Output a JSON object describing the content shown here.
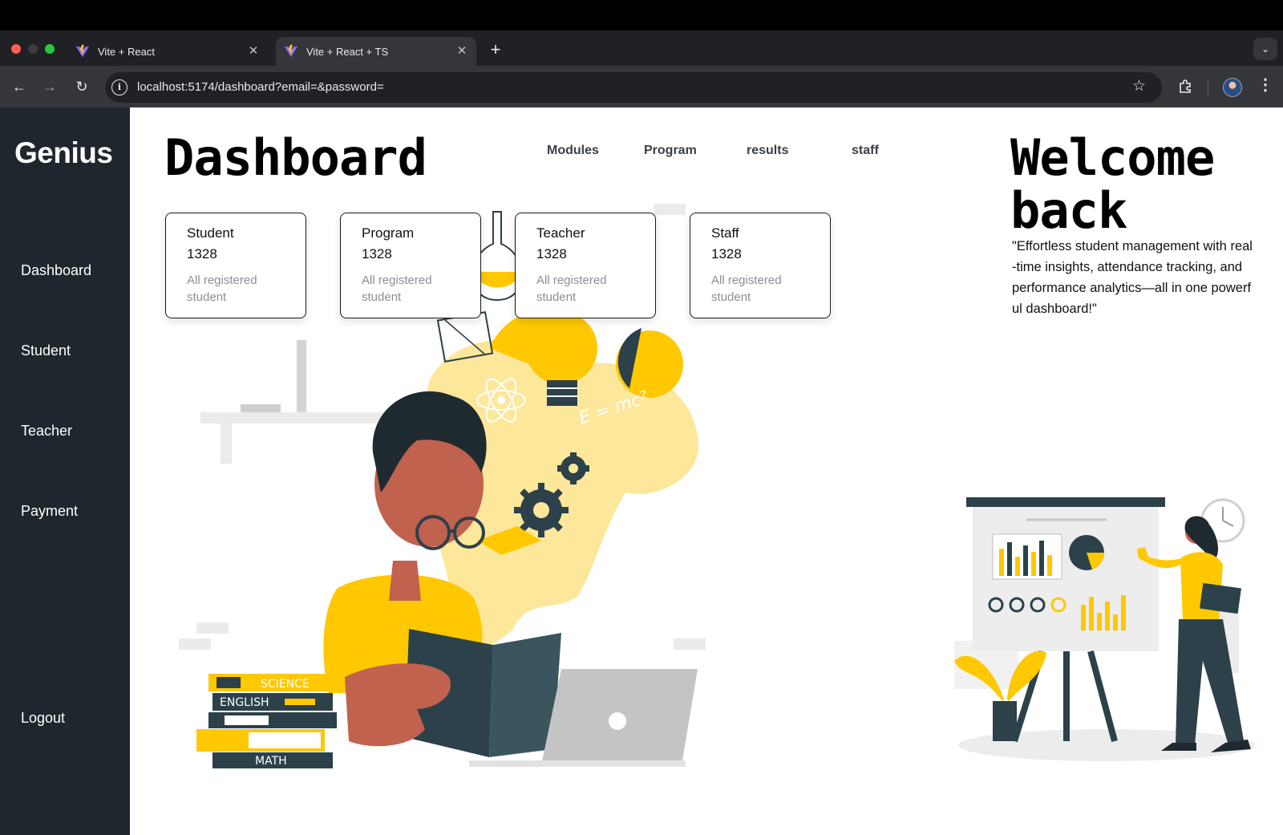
{
  "browser": {
    "tabs": [
      {
        "title": "Vite + React",
        "active": false
      },
      {
        "title": "Vite + React + TS",
        "active": true
      }
    ],
    "url": "localhost:5174/dashboard?email=&password="
  },
  "sidebar": {
    "brand": "Genius",
    "items": [
      {
        "label": "Dashboard"
      },
      {
        "label": "Student"
      },
      {
        "label": "Teacher"
      },
      {
        "label": "Payment"
      }
    ],
    "logout": "Logout"
  },
  "header": {
    "title": "Dashboard",
    "nav": [
      "Modules",
      "Program",
      "results",
      "staff"
    ]
  },
  "cards": [
    {
      "title": "Student",
      "value": "1328",
      "desc": "All registered student"
    },
    {
      "title": "Program",
      "value": "1328",
      "desc": "All registered student"
    },
    {
      "title": "Teacher",
      "value": "1328",
      "desc": "All registered student"
    },
    {
      "title": "Staff",
      "value": "1328",
      "desc": "All registered student"
    }
  ],
  "welcome": {
    "title": "Welcome back",
    "quote": "\"Effortless student management with real-time insights, attendance tracking, and performance analytics—all in one powerful dashboard!\""
  },
  "illustration": {
    "book_labels": [
      "SCIENCE",
      "ENGLISH",
      "MATH"
    ],
    "formula": "E = mc²"
  },
  "colors": {
    "sidebar": "#1f262e",
    "accent": "#ffc800",
    "ink": "#2c4149",
    "skin": "#c0624e"
  }
}
